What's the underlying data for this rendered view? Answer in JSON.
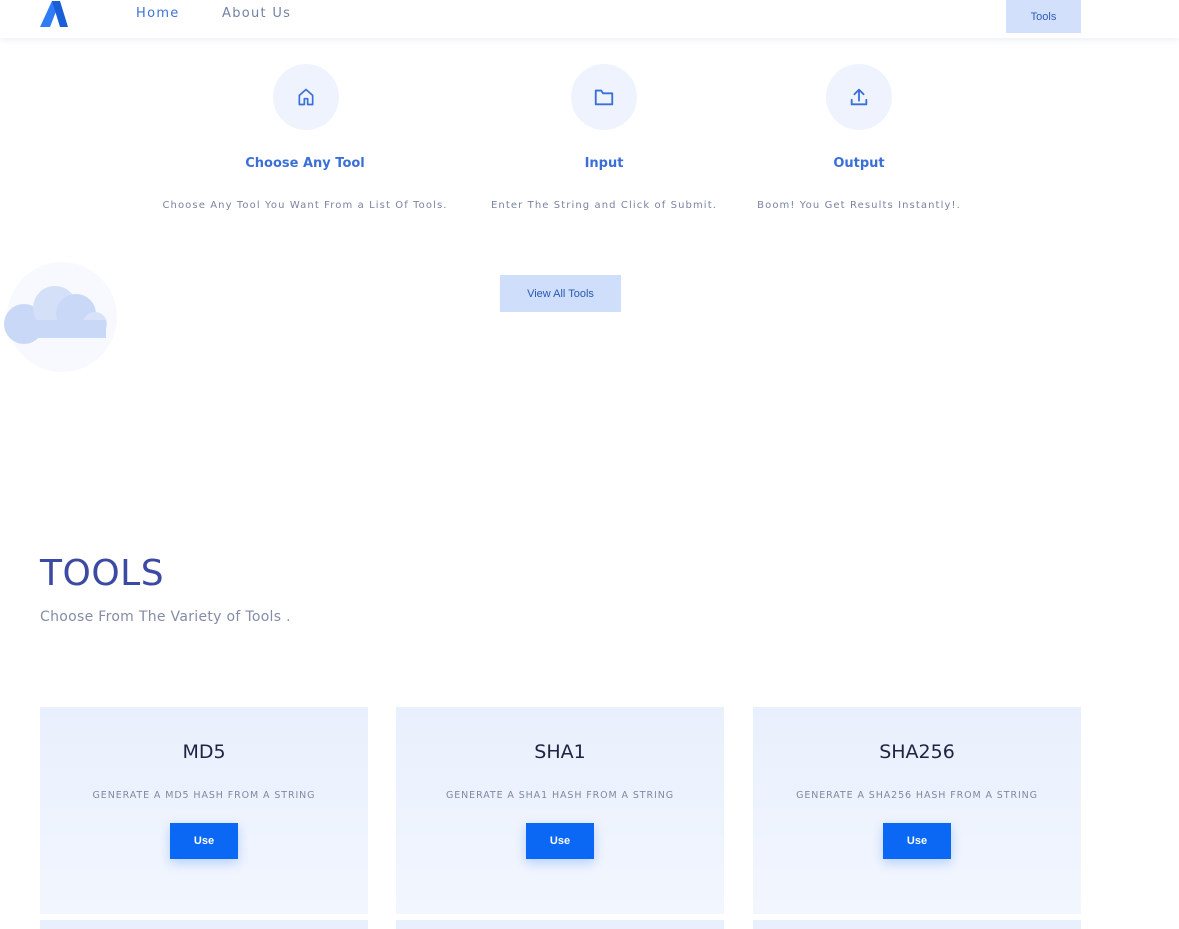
{
  "nav": {
    "links": [
      "Home",
      "About Us"
    ],
    "tools_button": "Tools"
  },
  "steps": [
    {
      "icon": "home-icon",
      "title": "Choose Any Tool",
      "desc": "Choose Any Tool You Want From a List Of Tools."
    },
    {
      "icon": "folder-icon",
      "title": "Input",
      "desc": "Enter The String and Click of Submit."
    },
    {
      "icon": "upload-icon",
      "title": "Output",
      "desc": "Boom! You Get Results Instantly!."
    }
  ],
  "view_all_label": "View All Tools",
  "tools_section": {
    "heading": "TOOLS",
    "subheading": "Choose From The Variety of Tools ."
  },
  "cards": [
    {
      "title": "MD5",
      "desc": "GENERATE A MD5 HASH FROM A STRING",
      "button": "Use"
    },
    {
      "title": "SHA1",
      "desc": "GENERATE A SHA1 HASH FROM A STRING",
      "button": "Use"
    },
    {
      "title": "SHA256",
      "desc": "GENERATE A SHA256 HASH FROM A STRING",
      "button": "Use"
    }
  ],
  "colors": {
    "accent": "#0a68f5",
    "heading": "#3c4aa3",
    "link": "#3d74d6"
  }
}
